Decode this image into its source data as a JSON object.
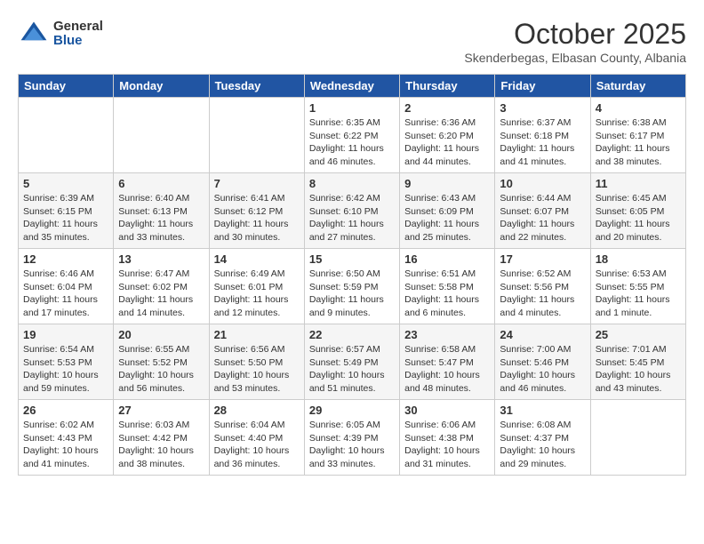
{
  "logo": {
    "general": "General",
    "blue": "Blue"
  },
  "title": "October 2025",
  "subtitle": "Skenderbegas, Elbasan County, Albania",
  "days_of_week": [
    "Sunday",
    "Monday",
    "Tuesday",
    "Wednesday",
    "Thursday",
    "Friday",
    "Saturday"
  ],
  "weeks": [
    [
      {
        "day": "",
        "content": ""
      },
      {
        "day": "",
        "content": ""
      },
      {
        "day": "",
        "content": ""
      },
      {
        "day": "1",
        "content": "Sunrise: 6:35 AM\nSunset: 6:22 PM\nDaylight: 11 hours\nand 46 minutes."
      },
      {
        "day": "2",
        "content": "Sunrise: 6:36 AM\nSunset: 6:20 PM\nDaylight: 11 hours\nand 44 minutes."
      },
      {
        "day": "3",
        "content": "Sunrise: 6:37 AM\nSunset: 6:18 PM\nDaylight: 11 hours\nand 41 minutes."
      },
      {
        "day": "4",
        "content": "Sunrise: 6:38 AM\nSunset: 6:17 PM\nDaylight: 11 hours\nand 38 minutes."
      }
    ],
    [
      {
        "day": "5",
        "content": "Sunrise: 6:39 AM\nSunset: 6:15 PM\nDaylight: 11 hours\nand 35 minutes."
      },
      {
        "day": "6",
        "content": "Sunrise: 6:40 AM\nSunset: 6:13 PM\nDaylight: 11 hours\nand 33 minutes."
      },
      {
        "day": "7",
        "content": "Sunrise: 6:41 AM\nSunset: 6:12 PM\nDaylight: 11 hours\nand 30 minutes."
      },
      {
        "day": "8",
        "content": "Sunrise: 6:42 AM\nSunset: 6:10 PM\nDaylight: 11 hours\nand 27 minutes."
      },
      {
        "day": "9",
        "content": "Sunrise: 6:43 AM\nSunset: 6:09 PM\nDaylight: 11 hours\nand 25 minutes."
      },
      {
        "day": "10",
        "content": "Sunrise: 6:44 AM\nSunset: 6:07 PM\nDaylight: 11 hours\nand 22 minutes."
      },
      {
        "day": "11",
        "content": "Sunrise: 6:45 AM\nSunset: 6:05 PM\nDaylight: 11 hours\nand 20 minutes."
      }
    ],
    [
      {
        "day": "12",
        "content": "Sunrise: 6:46 AM\nSunset: 6:04 PM\nDaylight: 11 hours\nand 17 minutes."
      },
      {
        "day": "13",
        "content": "Sunrise: 6:47 AM\nSunset: 6:02 PM\nDaylight: 11 hours\nand 14 minutes."
      },
      {
        "day": "14",
        "content": "Sunrise: 6:49 AM\nSunset: 6:01 PM\nDaylight: 11 hours\nand 12 minutes."
      },
      {
        "day": "15",
        "content": "Sunrise: 6:50 AM\nSunset: 5:59 PM\nDaylight: 11 hours\nand 9 minutes."
      },
      {
        "day": "16",
        "content": "Sunrise: 6:51 AM\nSunset: 5:58 PM\nDaylight: 11 hours\nand 6 minutes."
      },
      {
        "day": "17",
        "content": "Sunrise: 6:52 AM\nSunset: 5:56 PM\nDaylight: 11 hours\nand 4 minutes."
      },
      {
        "day": "18",
        "content": "Sunrise: 6:53 AM\nSunset: 5:55 PM\nDaylight: 11 hours\nand 1 minute."
      }
    ],
    [
      {
        "day": "19",
        "content": "Sunrise: 6:54 AM\nSunset: 5:53 PM\nDaylight: 10 hours\nand 59 minutes."
      },
      {
        "day": "20",
        "content": "Sunrise: 6:55 AM\nSunset: 5:52 PM\nDaylight: 10 hours\nand 56 minutes."
      },
      {
        "day": "21",
        "content": "Sunrise: 6:56 AM\nSunset: 5:50 PM\nDaylight: 10 hours\nand 53 minutes."
      },
      {
        "day": "22",
        "content": "Sunrise: 6:57 AM\nSunset: 5:49 PM\nDaylight: 10 hours\nand 51 minutes."
      },
      {
        "day": "23",
        "content": "Sunrise: 6:58 AM\nSunset: 5:47 PM\nDaylight: 10 hours\nand 48 minutes."
      },
      {
        "day": "24",
        "content": "Sunrise: 7:00 AM\nSunset: 5:46 PM\nDaylight: 10 hours\nand 46 minutes."
      },
      {
        "day": "25",
        "content": "Sunrise: 7:01 AM\nSunset: 5:45 PM\nDaylight: 10 hours\nand 43 minutes."
      }
    ],
    [
      {
        "day": "26",
        "content": "Sunrise: 6:02 AM\nSunset: 4:43 PM\nDaylight: 10 hours\nand 41 minutes."
      },
      {
        "day": "27",
        "content": "Sunrise: 6:03 AM\nSunset: 4:42 PM\nDaylight: 10 hours\nand 38 minutes."
      },
      {
        "day": "28",
        "content": "Sunrise: 6:04 AM\nSunset: 4:40 PM\nDaylight: 10 hours\nand 36 minutes."
      },
      {
        "day": "29",
        "content": "Sunrise: 6:05 AM\nSunset: 4:39 PM\nDaylight: 10 hours\nand 33 minutes."
      },
      {
        "day": "30",
        "content": "Sunrise: 6:06 AM\nSunset: 4:38 PM\nDaylight: 10 hours\nand 31 minutes."
      },
      {
        "day": "31",
        "content": "Sunrise: 6:08 AM\nSunset: 4:37 PM\nDaylight: 10 hours\nand 29 minutes."
      },
      {
        "day": "",
        "content": ""
      }
    ]
  ]
}
